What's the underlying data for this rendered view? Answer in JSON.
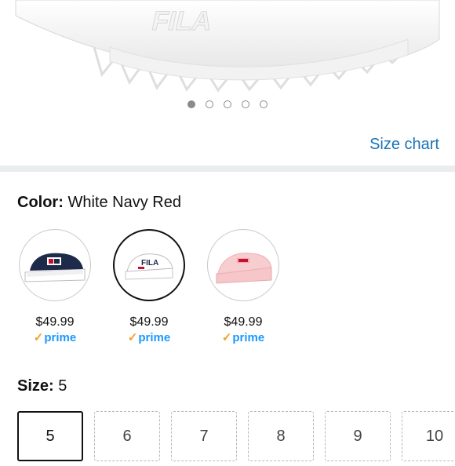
{
  "carousel": {
    "dot_count": 5,
    "active_index": 0
  },
  "size_chart_link": "Size chart",
  "color": {
    "label": "Color:",
    "value": "White Navy Red"
  },
  "swatches": [
    {
      "price": "$49.99",
      "prime": "prime",
      "icon": "navy-slide-sandal",
      "selected": false
    },
    {
      "price": "$49.99",
      "prime": "prime",
      "icon": "white-slide-sandal",
      "selected": true
    },
    {
      "price": "$49.99",
      "prime": "prime",
      "icon": "pink-slide-sandal",
      "selected": false
    }
  ],
  "size": {
    "label": "Size:",
    "value": "5",
    "options": [
      "5",
      "6",
      "7",
      "8",
      "9",
      "10"
    ],
    "selected_index": 0
  },
  "colors": {
    "link": "#1a73b8",
    "prime": "#1a98ff",
    "prime_check": "#f0a030"
  }
}
